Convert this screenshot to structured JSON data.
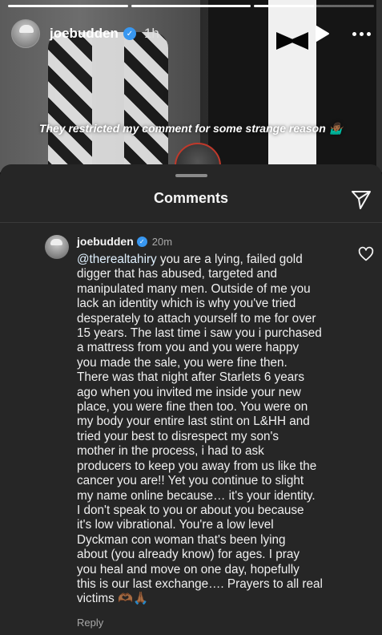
{
  "story": {
    "username": "joebudden",
    "time": "1h",
    "caption": "They restricted my comment for some strange reason 🤷🏾‍♂️",
    "progress": [
      1,
      1,
      0.5
    ]
  },
  "comments_sheet": {
    "title": "Comments",
    "comment": {
      "username": "joebudden",
      "time": "20m",
      "mention": "@therealtahiry",
      "body": " you are a lying, failed gold\ndigger that has abused, targeted and\nmanipulated many men. Outside of me you\nlack an identity which is why you've tried\ndesperately to attach yourself to me for over\n15 years. The last time i saw you i purchased\na mattress from you and you were happy\nyou made the  sale, you were fine then.\nThere was that night after Starlets 6 years\nago when you invited me inside your new\nplace, you were fine then too. You were on\nmy body your entire last stint on L&HH and\ntried your best to disrespect my son's\nmother in the process, i had to ask\nproducers to keep you away from us like the\ncancer you are!! Yet you continue to slight\nmy name online because… it's your identity.\nI don't speak to you or about you because\nit's low vibrational. You're a low level\nDyckman con woman that's been lying\nabout (you already know) for ages. I pray\nyou heal and move on one day, hopefully\nthis is our last exchange…. Prayers to all real\nvictims 🫶🏾🙏🏾",
      "reply_label": "Reply"
    }
  },
  "icons": {
    "play": "play-icon",
    "more": "more-icon",
    "send": "send-icon",
    "like": "heart-icon",
    "verified": "verified-badge-icon"
  }
}
